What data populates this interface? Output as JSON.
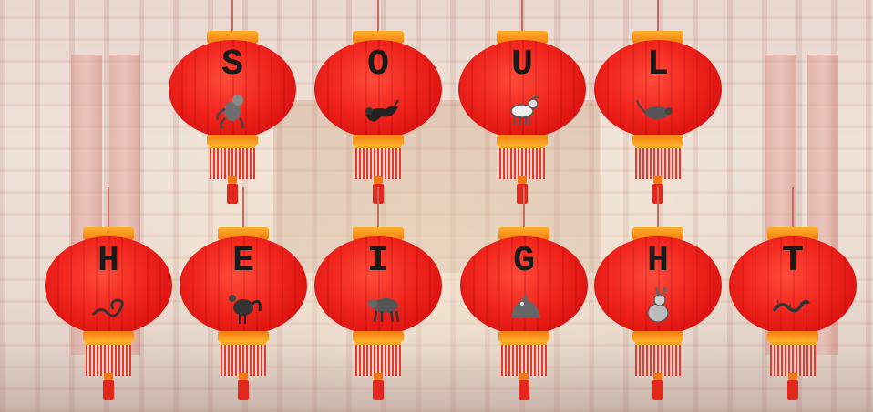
{
  "top_row": [
    {
      "letter": "S",
      "animal_icon": "monkey-icon"
    },
    {
      "letter": "O",
      "animal_icon": "dog-icon"
    },
    {
      "letter": "U",
      "animal_icon": "goat-icon"
    },
    {
      "letter": "L",
      "animal_icon": "rat-icon"
    }
  ],
  "bottom_row": [
    {
      "letter": "H",
      "animal_icon": "snake-icon"
    },
    {
      "letter": "E",
      "animal_icon": "rooster-icon"
    },
    {
      "letter": "I",
      "animal_icon": "ox-icon"
    },
    {
      "letter": "G",
      "animal_icon": "wolf-icon"
    },
    {
      "letter": "H",
      "animal_icon": "rabbit-icon"
    },
    {
      "letter": "T",
      "animal_icon": "dragon-icon"
    }
  ],
  "colors": {
    "lantern_red": "#e8191a",
    "cap_orange": "#f6a623",
    "letter": "#1a1a1a"
  }
}
